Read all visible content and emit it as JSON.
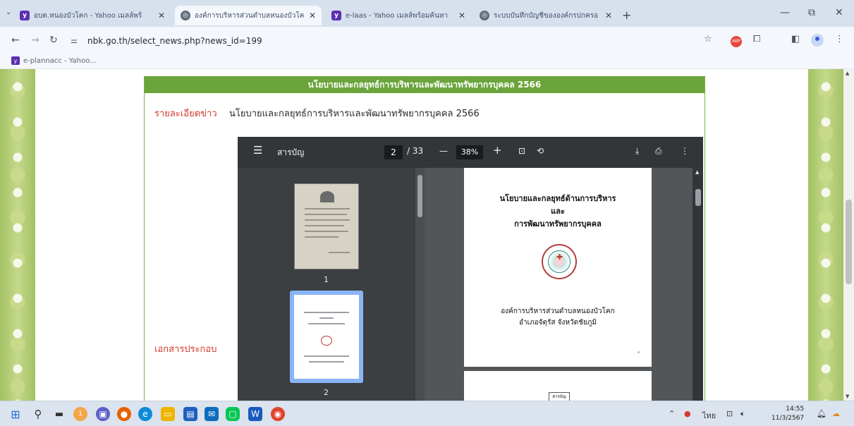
{
  "browser": {
    "tabs": [
      {
        "title": "อบต.หนองบัวโคก - Yahoo เมลล์พร้",
        "icon": "yahoo-mail-icon",
        "active": false
      },
      {
        "title": "องค์การบริหารส่วนตำบลหนองบัวโค",
        "icon": "globe-icon",
        "active": true
      },
      {
        "title": "e-laas - Yahoo เมลล์พร้อมค้นหา",
        "icon": "yahoo-mail-icon",
        "active": false
      },
      {
        "title": "ระบบบันทึกบัญชีขององค์กรปกครอ",
        "icon": "globe-icon",
        "active": false
      }
    ],
    "url": "nbk.go.th/select_news.php?news_id=199",
    "bookmark": "e-plannacc - Yahoo...",
    "accent": "#5b2fb0"
  },
  "news": {
    "header": "นโยบายและกลยุทธ์การบริหารและพัฒนาทรัพยากรบุคคล 2566",
    "detail_label": "รายละเอียดข่าว",
    "detail_value": "นโยบายและกลยุทธ์การบริหารและพัฒนาทรัพยากรบุคคล 2566",
    "attachment_label": "เอกสารประกอบ",
    "brand_green": "#6aa43a",
    "label_red": "#d23a2b"
  },
  "pdf": {
    "doc_title": "สารบัญ",
    "current_page": "2",
    "total_pages": "/ 33",
    "zoom": "38%",
    "thumb_labels": [
      "1",
      "2"
    ],
    "page1": {
      "title_line1": "นโยบายและกลยุทธ์ด้านการบริหาร",
      "title_line2": "และ",
      "title_line3": "การพัฒนาทรัพยากรบุคคล",
      "org_line1": "องค์การบริหารส่วนตำบลหนองบัวโคก",
      "org_line2": "อำเภอจัตุรัส  จังหวัดชัยภูมิ"
    },
    "page2_box": "สารบัญ"
  },
  "taskbar": {
    "lang": "ไทย",
    "time": "14:55",
    "date": "11/3/2567",
    "notif_badge": "1"
  }
}
